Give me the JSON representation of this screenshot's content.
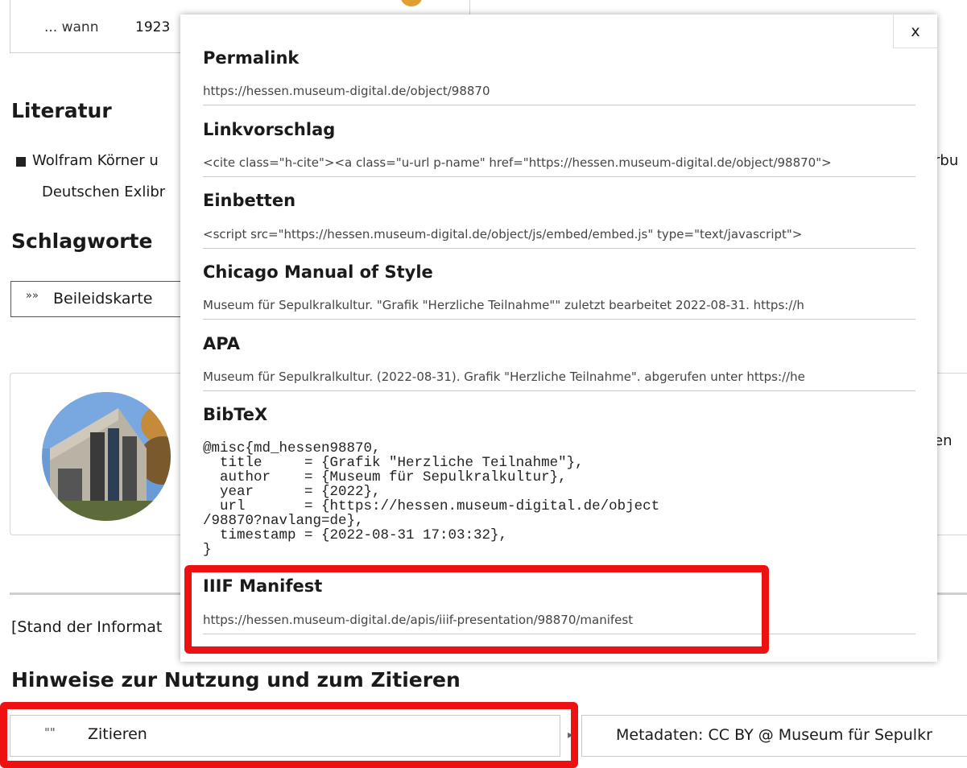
{
  "when": {
    "label": "... wann",
    "value": "1923"
  },
  "literature": {
    "heading": "Literatur",
    "line1": "Wolfram Körner u",
    "line2": "Deutschen Exlibr",
    "line1_right": "rbu"
  },
  "keywords": {
    "heading": "Schlagworte",
    "tag_icon": "»»",
    "tag_label": "Beileidskarte"
  },
  "institution_card": {
    "right_text": "en"
  },
  "stand": "[Stand der Informat",
  "usage": {
    "heading": "Hinweise zur Nutzung und zum Zitieren",
    "cite_icon": "\"\"",
    "cite_label": "Zitieren",
    "license_text": "Metadaten: CC BY @ Museum für Sepulkr"
  },
  "modal": {
    "close_label": "x",
    "sections": [
      {
        "title": "Permalink",
        "value": "https://hessen.museum-digital.de/object/98870"
      },
      {
        "title": "Linkvorschlag",
        "value": "<cite class=\"h-cite\"><a class=\"u-url p-name\" href=\"https://hessen.museum-digital.de/object/98870\">"
      },
      {
        "title": "Einbetten",
        "value": "<script src=\"https://hessen.museum-digital.de/object/js/embed/embed.js\" type=\"text/javascript\">"
      },
      {
        "title": "Chicago Manual of Style",
        "value": "Museum für Sepulkralkultur. \"Grafik \"Herzliche Teilnahme\"\" zuletzt bearbeitet 2022-08-31. https://h"
      },
      {
        "title": "APA",
        "value": "Museum für Sepulkralkultur. (2022-08-31). Grafik \"Herzliche Teilnahme\". abgerufen unter https://he"
      },
      {
        "title": "BibTeX"
      },
      {
        "title": "IIIF Manifest",
        "value": "https://hessen.museum-digital.de/apis/iiif-presentation/98870/manifest"
      }
    ],
    "bibtex": "@misc{md_hessen98870,\n  title     = {Grafik \"Herzliche Teilnahme\"},\n  author    = {Museum für Sepulkralkultur},\n  year      = {2022},\n  url       = {https://hessen.museum-digital.de/object\n/98870?navlang=de},\n  timestamp = {2022-08-31 17:03:32},\n}"
  },
  "colors": {
    "highlight": "#ee1111",
    "accent_orange": "#e0a030"
  }
}
